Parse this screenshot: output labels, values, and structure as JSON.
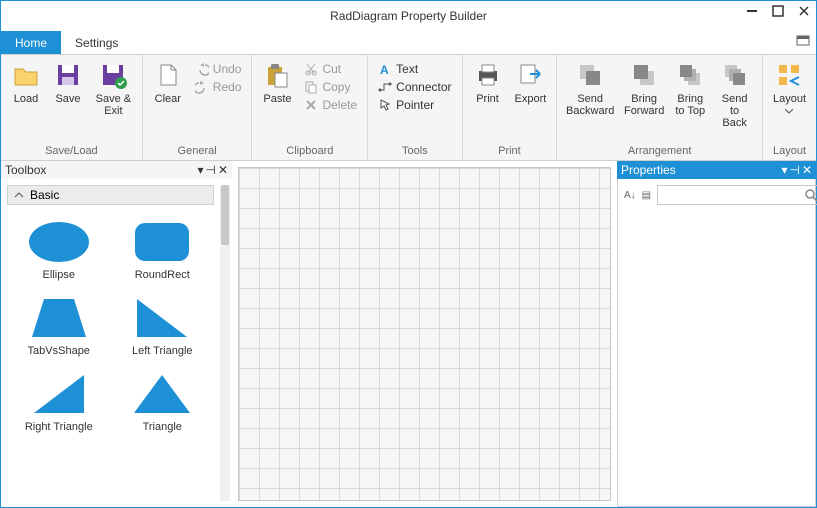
{
  "window": {
    "title": "RadDiagram Property Builder"
  },
  "tabs": {
    "home": "Home",
    "settings": "Settings"
  },
  "ribbon": {
    "saveLoad": {
      "label": "Save/Load",
      "load": "Load",
      "save": "Save",
      "saveExit": "Save & Exit"
    },
    "general": {
      "label": "General",
      "clear": "Clear",
      "undo": "Undo",
      "redo": "Redo"
    },
    "clipboard": {
      "label": "Clipboard",
      "paste": "Paste",
      "cut": "Cut",
      "copy": "Copy",
      "delete": "Delete"
    },
    "tools": {
      "label": "Tools",
      "text": "Text",
      "connector": "Connector",
      "pointer": "Pointer"
    },
    "print": {
      "label": "Print",
      "print": "Print",
      "export": "Export"
    },
    "arrange": {
      "label": "Arrangement",
      "sendBackward": "Send\nBackward",
      "bringForward": "Bring\nForward",
      "bringTop": "Bring\nto Top",
      "sendBack": "Send\nto Back"
    },
    "layout": {
      "label": "Layout",
      "layout": "Layout"
    }
  },
  "toolbox": {
    "title": "Toolbox",
    "category": "Basic",
    "shapes": {
      "ellipse": "Ellipse",
      "roundrect": "RoundRect",
      "tabvsshape": "TabVsShape",
      "lefttri": "Left Triangle",
      "righttri": "Right Triangle",
      "triangle": "Triangle"
    }
  },
  "properties": {
    "title": "Properties",
    "searchPlaceholder": ""
  },
  "colors": {
    "accent": "#1e90d6",
    "shape": "#1e90d6"
  }
}
